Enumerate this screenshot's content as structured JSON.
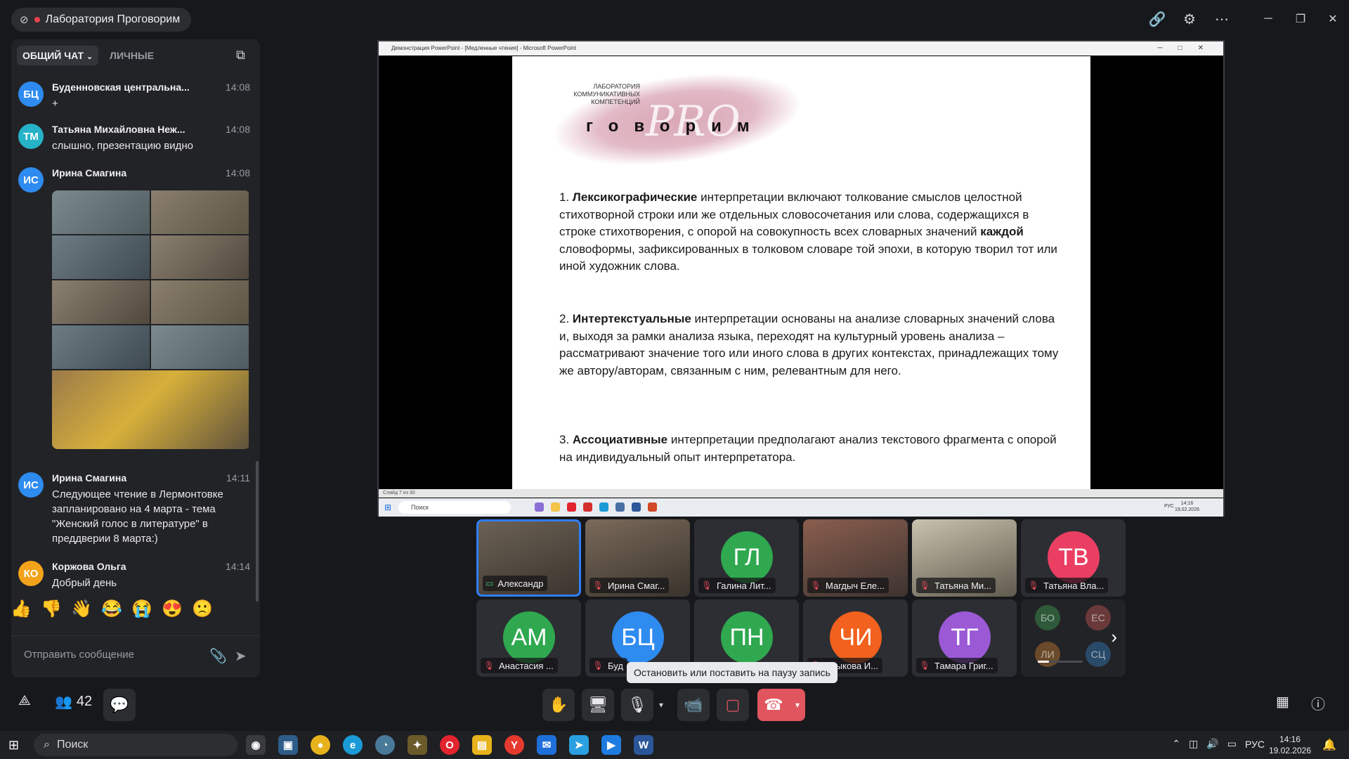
{
  "header": {
    "conference_title": "Лаборатория Проговорим",
    "colors": {
      "recording_dot": "#e8414a",
      "accent": "#2f7ef6"
    }
  },
  "chat": {
    "tabs": [
      {
        "label": "ОБЩИЙ ЧАТ",
        "active": true
      },
      {
        "label": "ЛИЧНЫЕ",
        "active": false
      }
    ],
    "messages": [
      {
        "initials": "БЦ",
        "avatar_color": "#2e8bf0",
        "name": "Буденновская центральна...",
        "time": "14:08",
        "text": "+"
      },
      {
        "initials": "ТМ",
        "avatar_color": "#26b3c7",
        "name": "Татьяна Михайловна Неж...",
        "time": "14:08",
        "text": "слышно, презентацию видно"
      },
      {
        "initials": "ИС",
        "avatar_color": "#2e8bf0",
        "name": "Ирина Смагина",
        "time": "14:08",
        "text": ""
      },
      {
        "initials": "ИС",
        "avatar_color": "#2e8bf0",
        "name": "Ирина Смагина",
        "time": "14:11",
        "text": "Следующее чтение в Лермонтовке запланировано на 4 марта - тема \"Женский голос в литературе\" в преддверии 8 марта:)"
      },
      {
        "initials": "КО",
        "avatar_color": "#f2a31b",
        "name": "Коржова Ольга",
        "time": "14:14",
        "text": "Добрый день"
      }
    ],
    "reactions": [
      "👍",
      "👎",
      "👋",
      "😂",
      "😭",
      "😍",
      "🙁"
    ],
    "composer_placeholder": "Отправить сообщение"
  },
  "screen_share": {
    "window_title": "Демонстрация PowerPoint - [Медленные чтения] - Microsoft PowerPoint",
    "slide": {
      "logo_top": "ЛАБОРАТОРИЯ КОММУНИКАТИВНЫХ КОМПЕТЕНЦИЙ",
      "logo_word": "говорим",
      "logo_pro": "PRO",
      "p1_num": "1.",
      "p1_bold": "Лексикографические",
      "p1_a": "интерпретации включают толкование смыслов целостной стихотворной строки или же отдельных словосочетания или слова, содержащихся в строке стихотворения, с опорой на совокупность всех словарных значений",
      "p1_bold2": "каждой",
      "p1_b": "словоформы, зафиксированных в толковом словаре той эпохи, в которую творил тот или иной художник слова.",
      "p2_num": "2.",
      "p2_bold": "Интертекстуальные",
      "p2_text": "интерпретации основаны на анализе словарных значений слова и, выходя за рамки анализа языка, переходят на культурный уровень анализа – рассматривают значение того или иного слова в других контекстах, принадлежащих тому же автору/авторам, связанным с ним, релевантным для него.",
      "p3_num": "3.",
      "p3_bold": "Ассоциативные",
      "p3_text": "интерпретации предполагают анализ текстового фрагмента с опорой на индивидуальный опыт интерпретатора."
    },
    "status_text": "Слайд 7 из 30",
    "inner_search": "Поиск",
    "inner_lang": "РУС",
    "inner_time": "14:16",
    "inner_date": "19.02.2026"
  },
  "participants": {
    "count": "42",
    "tiles": [
      {
        "name": "Александр",
        "type": "camera",
        "muted": false,
        "active": true
      },
      {
        "name": "Ирина Смаг...",
        "type": "camera",
        "muted": true,
        "active": false
      },
      {
        "name": "Галина Лит...",
        "initials": "ГЛ",
        "color": "#2fa84f",
        "muted": true
      },
      {
        "name": "Магдыч Еле...",
        "type": "camera",
        "muted": true,
        "active": false
      },
      {
        "name": "Татьяна Ми...",
        "type": "camera",
        "muted": true,
        "active": false
      },
      {
        "name": "Татьяна Вла...",
        "initials": "ТВ",
        "color": "#ea3f63",
        "muted": true
      },
      {
        "name": "Анастасия ...",
        "initials": "АМ",
        "color": "#2fa84f",
        "muted": true
      },
      {
        "name": "Буд",
        "initials": "БЦ",
        "color": "#2e8bf0",
        "muted": true
      },
      {
        "name": "",
        "initials": "ПН",
        "color": "#2fa84f",
        "muted": true
      },
      {
        "name": "Крыкова И...",
        "initials": "ЧИ",
        "color": "#f2611d",
        "muted": true
      },
      {
        "name": "Тамара Григ...",
        "initials": "ТГ",
        "color": "#9b59d6",
        "muted": true
      }
    ],
    "more": [
      "БО",
      "ЕС",
      "ЛИ",
      "СЦ"
    ]
  },
  "tooltip": "Остановить или поставить на паузу запись",
  "taskbar": {
    "search_placeholder": "Поиск",
    "lang": "РУС",
    "time": "14:16",
    "date": "19.02.2026"
  }
}
